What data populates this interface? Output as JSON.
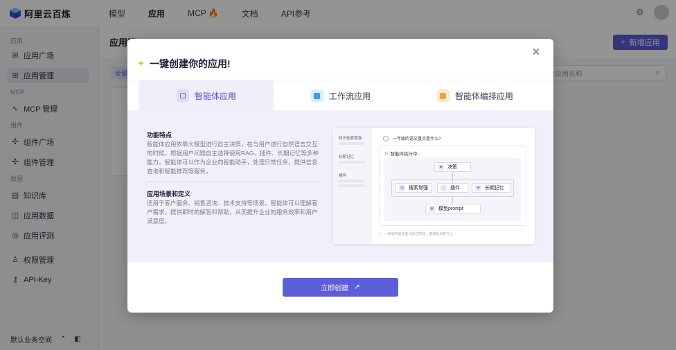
{
  "app": {
    "logo_text": "阿里云百炼",
    "nav": [
      "模型",
      "应用",
      "MCP 🔥",
      "文档",
      "API参考"
    ],
    "active_nav": "应用"
  },
  "sidebar": {
    "groups": [
      {
        "label": "应用",
        "items": [
          {
            "label": "应用广场",
            "icon": "grid-icon"
          },
          {
            "label": "应用管理",
            "icon": "grid-icon",
            "active": true
          }
        ]
      },
      {
        "label": "MCP",
        "items": [
          {
            "label": "MCP 管理",
            "icon": "mcp-icon"
          }
        ]
      },
      {
        "label": "组件",
        "items": [
          {
            "label": "组件广场",
            "icon": "puzzle-icon"
          },
          {
            "label": "组件管理",
            "icon": "puzzle-icon"
          }
        ]
      },
      {
        "label": "数据",
        "items": [
          {
            "label": "知识库",
            "icon": "book-icon"
          },
          {
            "label": "应用数据",
            "icon": "chart-icon"
          },
          {
            "label": "应用评测",
            "icon": "compass-icon"
          },
          {
            "label": "权限管理",
            "icon": "user-icon"
          },
          {
            "label": "API-Key",
            "icon": "key-icon"
          }
        ]
      }
    ],
    "footer": "默认业务空间"
  },
  "main": {
    "title": "应用管",
    "new_button": "新增应用",
    "search_placeholder": "索应用名称",
    "filter_label": "全部"
  },
  "modal": {
    "title": "一键创建你的应用!",
    "tabs": [
      {
        "label": "智能体应用",
        "active": true,
        "icon_color": "#6b6de0"
      },
      {
        "label": "工作流应用",
        "active": false,
        "icon_color": "#3f9ae6"
      },
      {
        "label": "智能体编排应用",
        "active": false,
        "icon_color": "#f0a33a"
      }
    ],
    "features_title": "功能特点",
    "features_text": "智能体应用依靠大模型进行自主决策，在与用户进行自然语言交互的时候，根据用户问题自主选择使用RAG、插件、长期记忆等多种能力。智能体可以作为企业的智能助手，处理日常任务，提供信息查询和智能推荐等服务。",
    "scenario_title": "应用场景和定义",
    "scenario_text": "适用于客户服务、销售咨询、技术支持等场景。智能体可以理解客户需求，提供即时的解答和帮助，从而提升企业的服务效率和用户满意度。",
    "illustration": {
      "side_items": [
        "知识检索增强",
        "长期记忆",
        "插件"
      ],
      "question": "一年级的语文重点是什么?",
      "executing": "智能体执行中...",
      "nodes": {
        "decision": "决策",
        "search": "搜索增强",
        "plugin": "插件",
        "memory": "长期记忆",
        "model": "模型prompt"
      },
      "input_hint": "一年级的语文重点是在拼音，掌握标点符号上"
    },
    "create_button": "立即创建"
  }
}
